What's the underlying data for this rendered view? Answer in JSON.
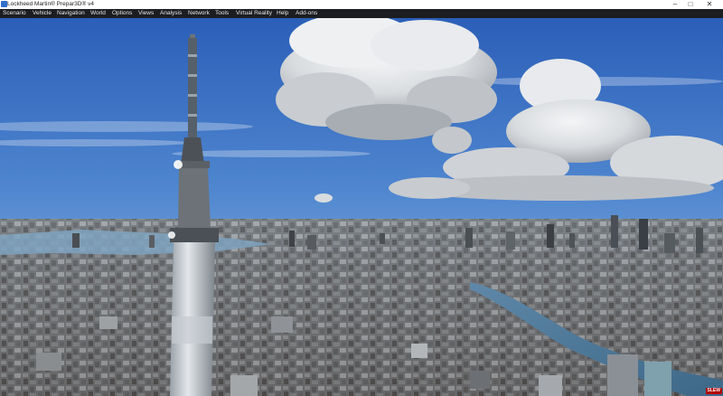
{
  "window": {
    "title": "Lockheed Martin® Prepar3D® v4",
    "controls": {
      "minimize": "–",
      "maximize": "□",
      "close": "✕"
    }
  },
  "menu": {
    "items": [
      {
        "label": "Scenario"
      },
      {
        "label": "Vehicle"
      },
      {
        "label": "Navigation"
      },
      {
        "label": "World"
      },
      {
        "label": "Options"
      },
      {
        "label": "Views"
      },
      {
        "label": "Analysis"
      },
      {
        "label": "Network"
      },
      {
        "label": "Tools"
      },
      {
        "label": "Virtual Reality"
      },
      {
        "label": "Help"
      },
      {
        "label": "Add-ons"
      }
    ]
  },
  "status": {
    "mode_badge": "SLEW"
  },
  "colors": {
    "menubar": "#1b1d20",
    "sky_top": "#2b5fb8",
    "sky_horizon": "#a9c7e6",
    "accent": "#b00000"
  }
}
